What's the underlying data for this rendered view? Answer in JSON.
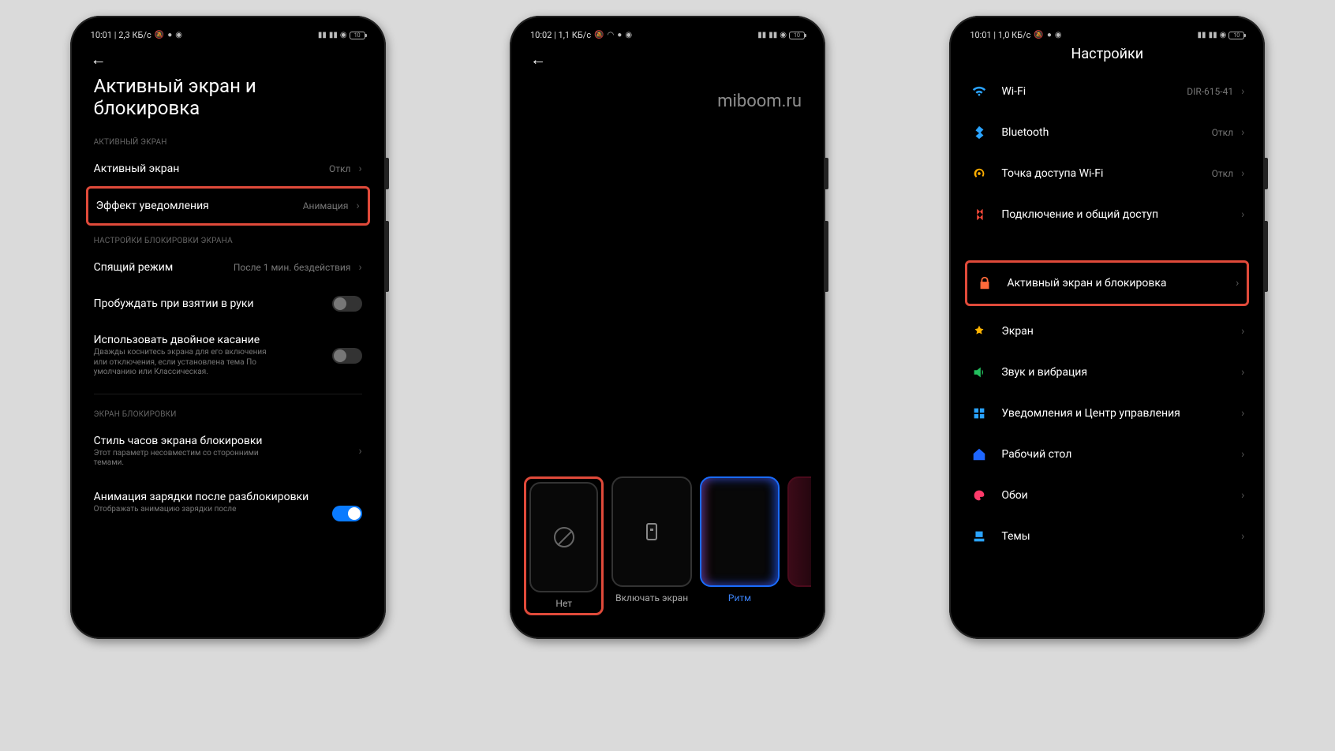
{
  "watermark": "miboom.ru",
  "phone1": {
    "status_left": "10:01 | 2,3 КБ/с",
    "title": "Активный экран и блокировка",
    "section1": "АКТИВНЫЙ ЭКРАН",
    "row_active_screen": {
      "label": "Активный экран",
      "value": "Откл"
    },
    "row_notif_effect": {
      "label": "Эффект уведомления",
      "value": "Анимация"
    },
    "section2": "НАСТРОЙКИ БЛОКИРОВКИ ЭКРАНА",
    "row_sleep": {
      "label": "Спящий режим",
      "value": "После 1 мин. бездействия"
    },
    "row_wake_pickup": {
      "label": "Пробуждать при взятии в руки"
    },
    "row_double_tap": {
      "label": "Использовать двойное касание",
      "sub": "Дважды коснитесь экрана для его включения или отключения, если установлена тема По умолчанию или Классическая."
    },
    "section3": "ЭКРАН БЛОКИРОВКИ",
    "row_clock_style": {
      "label": "Стиль часов экрана блокировки",
      "sub": "Этот параметр несовместим со сторонними темами."
    },
    "row_charge_anim": {
      "label": "Анимация зарядки после разблокировки",
      "sub": "Отображать анимацию зарядки после"
    }
  },
  "phone2": {
    "status_left": "10:02 | 1,1 КБ/с",
    "effects": [
      {
        "key": "none",
        "label": "Нет"
      },
      {
        "key": "wake",
        "label": "Включать экран"
      },
      {
        "key": "rhythm",
        "label": "Ритм"
      }
    ]
  },
  "phone3": {
    "status_left": "10:01 | 1,0 КБ/с",
    "title": "Настройки",
    "items": [
      {
        "label": "Wi-Fi",
        "value": "DIR-615-41",
        "color": "#2aa3ff"
      },
      {
        "label": "Bluetooth",
        "value": "Откл",
        "color": "#2aa3ff"
      },
      {
        "label": "Точка доступа Wi-Fi",
        "value": "Откл",
        "color": "#ffae00"
      },
      {
        "label": "Подключение и общий доступ",
        "value": "",
        "color": "#ff4a3a"
      },
      {
        "label": "Активный экран и блокировка",
        "value": "",
        "color": "#ff6a3a",
        "hl": true
      },
      {
        "label": "Экран",
        "value": "",
        "color": "#ffb400"
      },
      {
        "label": "Звук и вибрация",
        "value": "",
        "color": "#23c05e"
      },
      {
        "label": "Уведомления и Центр управления",
        "value": "",
        "color": "#2aa3ff"
      },
      {
        "label": "Рабочий стол",
        "value": "",
        "color": "#1e66ff"
      },
      {
        "label": "Обои",
        "value": "",
        "color": "#ff3a6a"
      },
      {
        "label": "Темы",
        "value": "",
        "color": "#2aa3ff"
      }
    ]
  },
  "battery_text": "10"
}
